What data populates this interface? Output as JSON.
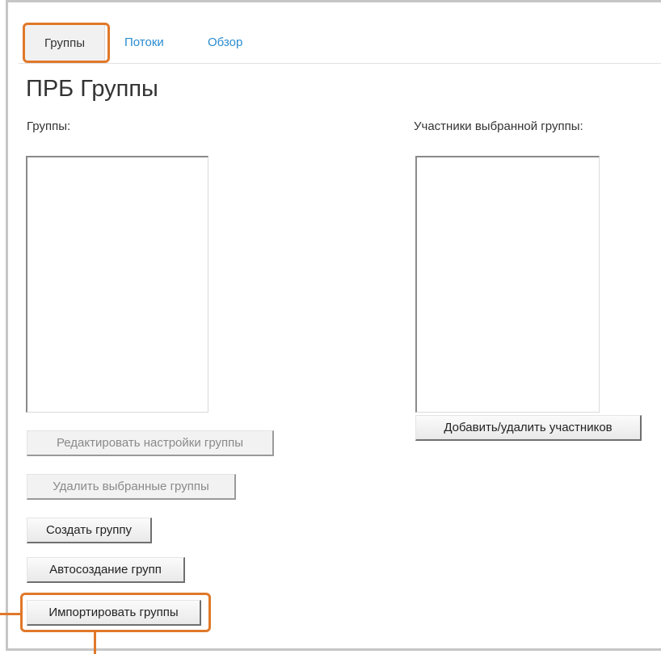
{
  "tabs": {
    "groups": "Группы",
    "threads": "Потоки",
    "overview": "Обзор"
  },
  "page": {
    "title": "ПРБ Группы"
  },
  "groups_panel": {
    "label": "Группы:",
    "buttons": {
      "edit": "Редактировать настройки группы",
      "delete": "Удалить выбранные группы",
      "create": "Создать группу",
      "autocreate": "Автосоздание групп",
      "import": "Импортировать группы"
    }
  },
  "members_panel": {
    "label": "Участники выбранной группы:",
    "button": "Добавить/удалить участников"
  },
  "colors": {
    "highlight": "#e0782a",
    "link": "#2a8ccf"
  }
}
